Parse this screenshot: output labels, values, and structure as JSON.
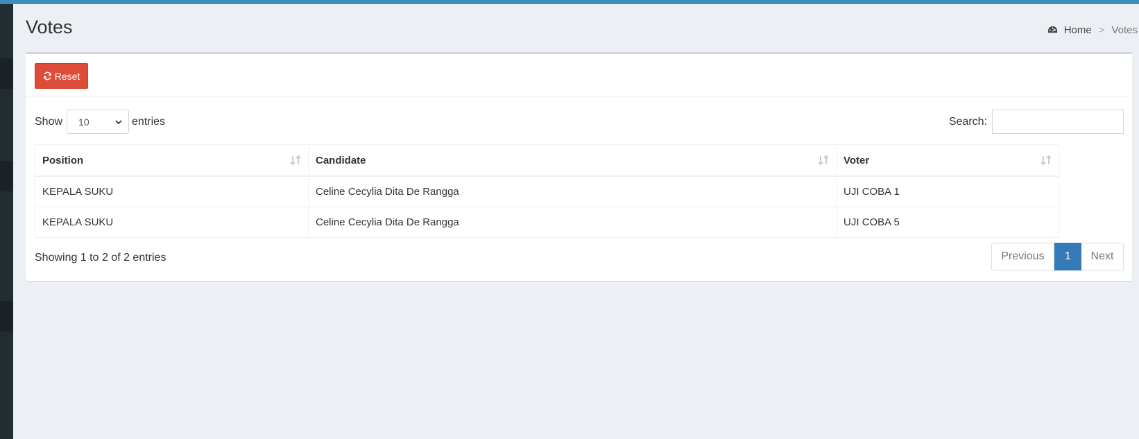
{
  "header": {
    "title": "Votes",
    "breadcrumb": {
      "icon": "dashboard-icon",
      "home": "Home",
      "separator": ">",
      "current": "Votes"
    }
  },
  "toolbar": {
    "reset_label": "Reset",
    "reset_icon": "refresh-icon"
  },
  "length_control": {
    "show_label": "Show",
    "selected": "10",
    "entries_label": "entries"
  },
  "search": {
    "label": "Search:",
    "value": "",
    "placeholder": ""
  },
  "table": {
    "columns": [
      "Position",
      "Candidate",
      "Voter"
    ],
    "rows": [
      [
        "KEPALA SUKU",
        "Celine Cecylia Dita De Rangga",
        "UJI COBA 1"
      ],
      [
        "KEPALA SUKU",
        "Celine Cecylia Dita De Rangga",
        "UJI COBA 5"
      ]
    ]
  },
  "footer": {
    "info": "Showing 1 to 2 of 2 entries",
    "pagination": {
      "previous": "Previous",
      "current_page": "1",
      "next": "Next"
    }
  },
  "colors": {
    "accent": "#3c8dbc",
    "danger": "#dd4b39",
    "primary": "#337ab7",
    "sidebar": "#222d32",
    "background": "#ecf0f5"
  }
}
